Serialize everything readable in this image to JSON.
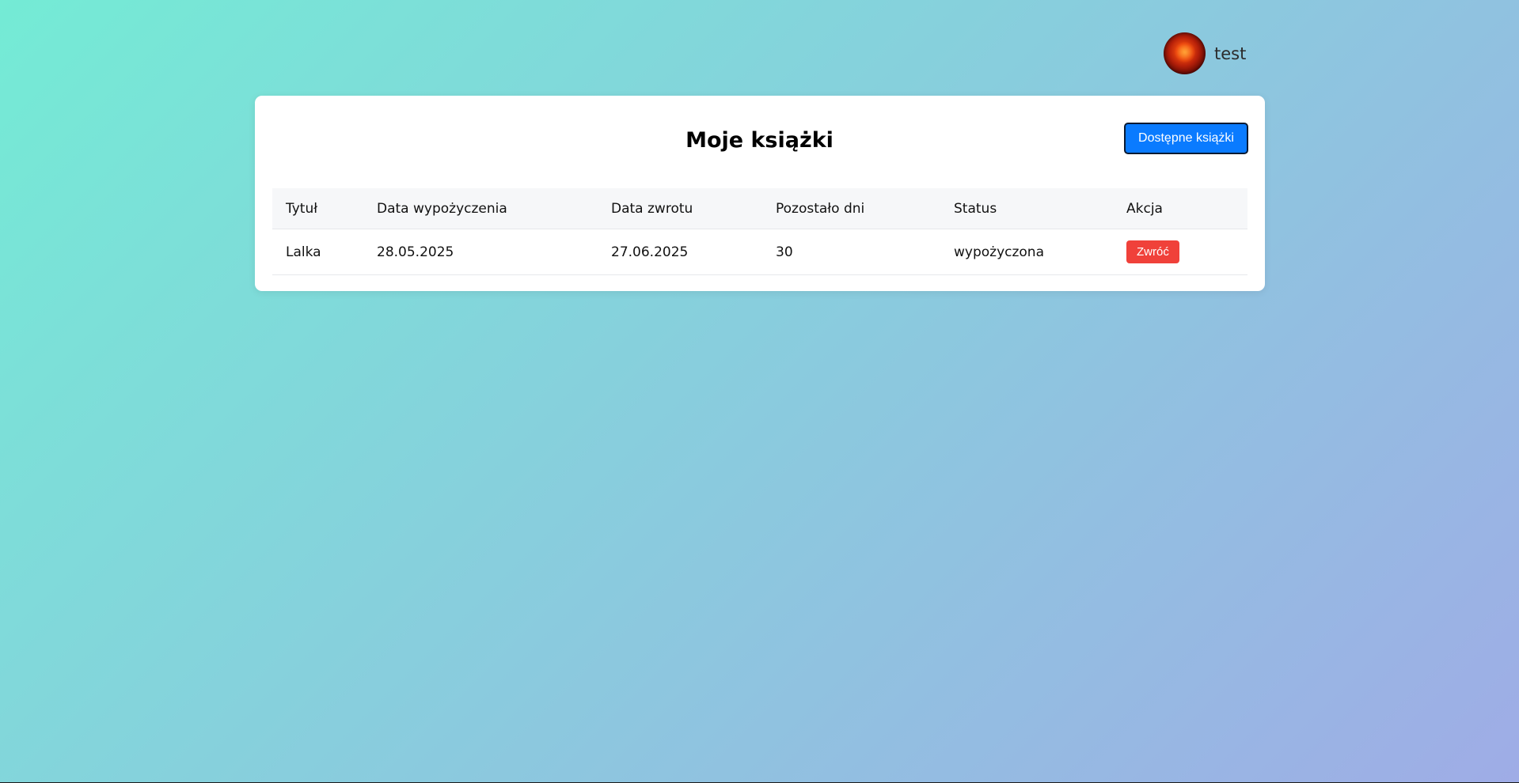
{
  "user": {
    "name": "test"
  },
  "page": {
    "title": "Moje książki",
    "available_button": "Dostępne książki"
  },
  "table": {
    "headers": [
      "Tytuł",
      "Data wypożyczenia",
      "Data zwrotu",
      "Pozostało dni",
      "Status",
      "Akcja"
    ],
    "rows": [
      {
        "title": "Lalka",
        "borrow_date": "28.05.2025",
        "return_date": "27.06.2025",
        "days_left": "30",
        "status": "wypożyczona",
        "action": "Zwróć"
      }
    ]
  },
  "colors": {
    "background_start": "#74ebd5",
    "background_end": "#9face6",
    "primary": "#0a7bff",
    "danger": "#f0413a"
  }
}
